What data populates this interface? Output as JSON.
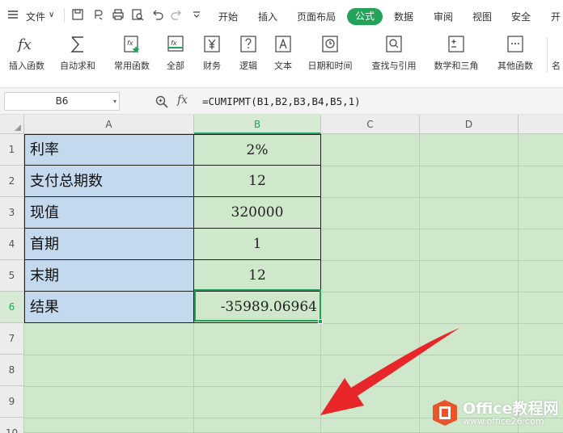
{
  "menubar": {
    "file": "文件",
    "tabs": [
      "开始",
      "插入",
      "页面布局",
      "公式",
      "数据",
      "审阅",
      "视图",
      "安全",
      "开"
    ],
    "active_tab": "公式"
  },
  "ribbon": {
    "buttons": [
      "插入函数",
      "自动求和",
      "常用函数",
      "全部",
      "财务",
      "逻辑",
      "文本",
      "日期和时间",
      "查找与引用",
      "数学和三角",
      "其他函数",
      "名"
    ]
  },
  "formula_bar": {
    "cell_ref": "B6",
    "fx": "fx",
    "formula": "=CUMIPMT(B1,B2,B3,B4,B5,1)"
  },
  "grid": {
    "columns": [
      "A",
      "B",
      "C",
      "D"
    ],
    "rows": [
      "1",
      "2",
      "3",
      "4",
      "5",
      "6",
      "7",
      "8",
      "9",
      "10"
    ],
    "data": [
      {
        "label": "利率",
        "value": "2%"
      },
      {
        "label": "支付总期数",
        "value": "12"
      },
      {
        "label": "现值",
        "value": "320000"
      },
      {
        "label": "首期",
        "value": "1"
      },
      {
        "label": "末期",
        "value": "12"
      },
      {
        "label": "结果",
        "value": "-35989.06964"
      }
    ]
  },
  "watermark": {
    "title": "Office教程网",
    "url": "www.office26.com"
  },
  "colors": {
    "accent": "#23a35a",
    "label_fill": "#c5d9ee",
    "sheet_fill": "#cfe8cc",
    "arrow": "#e8262a",
    "logo": "#e8552a"
  }
}
